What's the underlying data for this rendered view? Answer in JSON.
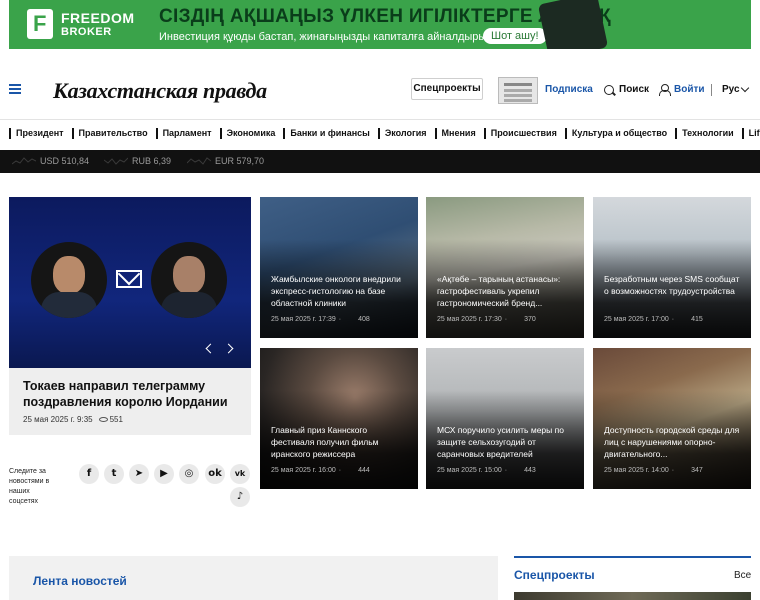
{
  "ad": {
    "brand": "FREEDOM",
    "brand_sub": "BROKER",
    "headline": "СІЗДІҢ АҚШАҢЫЗ ҮЛКЕН ИГІЛІКТЕРГЕ ЛАЙЫҚ",
    "subline": "Инвестиция құюды бастап, жинағыңызды капиталға айналдырыңыз",
    "button": "Шот ашу!"
  },
  "header": {
    "logo": "Казахстанская правда",
    "specprojects_button": "Спецпроекты",
    "subscribe": "Подписка",
    "search": "Поиск",
    "login": "Войти",
    "language": "Рус"
  },
  "nav": [
    "Президент",
    "Правительство",
    "Парламент",
    "Экономика",
    "Банки и финансы",
    "Экология",
    "Мнения",
    "Происшествия",
    "Культура и общество",
    "Технологии",
    "Lifest"
  ],
  "currency": [
    {
      "label": "USD 510,84"
    },
    {
      "label": "RUB 6,39"
    },
    {
      "label": "EUR 579,70"
    }
  ],
  "feature": {
    "title": "Токаев направил телеграмму поздравления королю Иордании",
    "date": "25 мая 2025 г. 9:35",
    "views": "551"
  },
  "cards": [
    {
      "title": "Жамбылские онкологи внедрили экспресс-гистологию на базе областной клиники",
      "date": "25 мая 2025 г. 17:39",
      "views": "408"
    },
    {
      "title": "«Ақтөбе – тарының астанасы»: гастрофестиваль укрепил гастрономический бренд...",
      "date": "25 мая 2025 г. 17:30",
      "views": "370"
    },
    {
      "title": "Безработным через SMS сообщат о возможностях трудоустройства",
      "date": "25 мая 2025 г. 17:00",
      "views": "415"
    },
    {
      "title": "Главный приз Каннского фестиваля получил фильм иранского режиссера",
      "date": "25 мая 2025 г. 16:00",
      "views": "444"
    },
    {
      "title": "МСХ поручило усилить меры по защите сельхозугодий от саранчовых вредителей",
      "date": "25 мая 2025 г. 15:00",
      "views": "443"
    },
    {
      "title": "Доступность городской среды для лиц с нарушениями опорно-двигательного...",
      "date": "25 мая 2025 г. 14:00",
      "views": "347"
    }
  ],
  "social": {
    "label": "Следите за новостями в наших соцсетях",
    "icons": [
      "facebook-icon",
      "twitter-icon",
      "telegram-icon",
      "youtube-icon",
      "instagram-icon",
      "odnoklassniki-icon",
      "vk-icon",
      "tiktok-icon"
    ]
  },
  "bottom": {
    "news_feed": "Лента новостей",
    "specprojects": "Спецпроекты",
    "all": "Все"
  }
}
